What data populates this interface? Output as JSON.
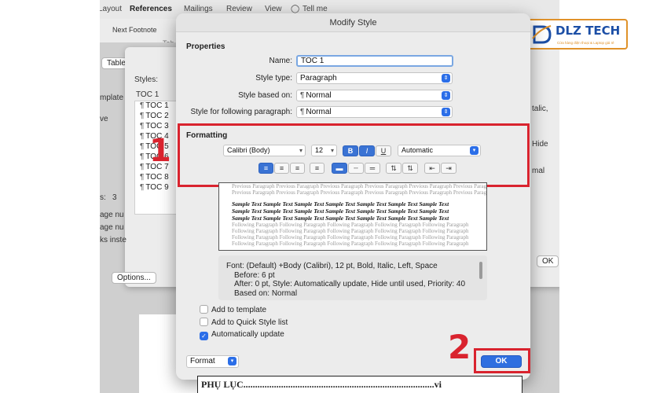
{
  "background": {
    "ribbon_tabs": [
      "Layout",
      "References",
      "Mailings",
      "Review",
      "View",
      "Tell me"
    ],
    "next_footnote": "Next Footnote",
    "tab_fragment": "Tab",
    "table_button": "Table",
    "styles_label": "Styles:",
    "styles_input": "TOC 1",
    "styles_list": [
      "TOC 1",
      "TOC 2",
      "TOC 3",
      "TOC 4",
      "TOC 5",
      "TOC 6",
      "TOC 7",
      "TOC 8",
      "TOC 9"
    ],
    "left_texts": [
      "mplate",
      "ve",
      "s:",
      "3",
      "age nu",
      "age nu",
      "ks inste"
    ],
    "right_texts": [
      "talic,",
      "Hide",
      "mal"
    ],
    "options_button": "Options...",
    "back_ok": "OK",
    "toc_line": "PHỤ LỤC.................................................................................vi"
  },
  "dialog": {
    "title": "Modify Style",
    "properties_heading": "Properties",
    "name_label": "Name:",
    "name_value": "TOC 1",
    "style_type_label": "Style type:",
    "style_type_value": "Paragraph",
    "based_on_label": "Style based on:",
    "based_on_value": "Normal",
    "following_label": "Style for following paragraph:",
    "following_value": "Normal",
    "formatting_heading": "Formatting",
    "font_value": "Calibri (Body)",
    "size_value": "12",
    "bold": "B",
    "italic": "I",
    "underline": "U",
    "color_value": "Automatic",
    "preview_previous": "Previous Paragraph Previous Paragraph Previous Paragraph Previous Paragraph Previous Paragraph Previous Paragraph",
    "preview_sample": "Sample Text Sample Text Sample Text Sample Text Sample Text Sample Text Sample Text",
    "preview_following": "Following Paragraph Following Paragraph Following Paragraph Following Paragraph Following Paragraph",
    "description_lines": [
      "Font: (Default) +Body (Calibri), 12 pt, Bold, Italic, Left, Space",
      "Before:  6 pt",
      "After:  0 pt, Style: Automatically update, Hide until used, Priority: 40",
      "Based on: Normal"
    ],
    "add_template": "Add to template",
    "add_quick": "Add to Quick Style list",
    "auto_update": "Automatically update",
    "format_button": "Format",
    "ok_button": "OK"
  },
  "annotations": {
    "step1": "1",
    "step2": "2"
  },
  "logo": {
    "text": "DLZ TECH",
    "sub": "Cửa hàng điện thoại & Laptop giá rẻ"
  },
  "colors": {
    "highlight_red": "#d9232e",
    "accent_blue": "#2f6fe0",
    "logo_orange": "#e0922a",
    "logo_blue": "#1c4fa6"
  }
}
